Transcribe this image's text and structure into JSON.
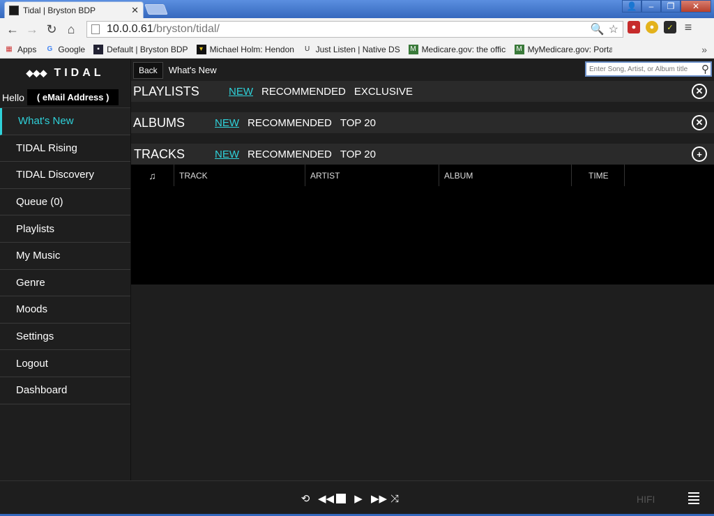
{
  "browser": {
    "tab_title": "Tidal | Bryston BDP",
    "url_host": "10.0.0.61",
    "url_path": "/bryston/tidal/",
    "bookmarks": [
      {
        "label": "Apps",
        "icon": "apps-grid-icon"
      },
      {
        "label": "Google",
        "icon": "google-icon"
      },
      {
        "label": "Default | Bryston BDP",
        "icon": "bryston-icon"
      },
      {
        "label": "Michael Holm: Hendon M",
        "icon": "batman-icon"
      },
      {
        "label": "Just Listen | Native DSD",
        "icon": "shield-u-icon"
      },
      {
        "label": "Medicare.gov: the offici",
        "icon": "medicare-icon"
      },
      {
        "label": "MyMedicare.gov: Portal",
        "icon": "medicare-icon"
      }
    ]
  },
  "app": {
    "logo_text": "TIDAL",
    "greeting": "Hello",
    "email_placeholder": "( eMail Address )",
    "nav": [
      {
        "label": "What's New",
        "active": true
      },
      {
        "label": "TIDAL Rising"
      },
      {
        "label": "TIDAL Discovery"
      },
      {
        "label": "Queue (0)"
      },
      {
        "label": "Playlists"
      },
      {
        "label": "My Music"
      },
      {
        "label": "Genre"
      },
      {
        "label": "Moods"
      },
      {
        "label": "Settings"
      },
      {
        "label": "Logout"
      },
      {
        "label": "Dashboard"
      }
    ],
    "back_label": "Back",
    "breadcrumb": "What's New",
    "search_placeholder": "Enter Song, Artist, or Album title",
    "sections": {
      "playlists": {
        "title": "PLAYLISTS",
        "tabs": [
          "NEW",
          "RECOMMENDED",
          "EXCLUSIVE"
        ],
        "button": "close-circle-icon"
      },
      "albums": {
        "title": "ALBUMS",
        "tabs": [
          "NEW",
          "RECOMMENDED",
          "TOP 20"
        ],
        "button": "close-circle-icon"
      },
      "tracks": {
        "title": "TRACKS",
        "tabs": [
          "NEW",
          "RECOMMENDED",
          "TOP 20"
        ],
        "button": "plus-circle-icon"
      }
    },
    "table_headers": [
      "TRACK",
      "ARTIST",
      "ALBUM",
      "TIME"
    ],
    "player": {
      "quality": "HIFI"
    },
    "colors": {
      "accent": "#2fd1d9",
      "background": "#1e1e1e"
    }
  }
}
